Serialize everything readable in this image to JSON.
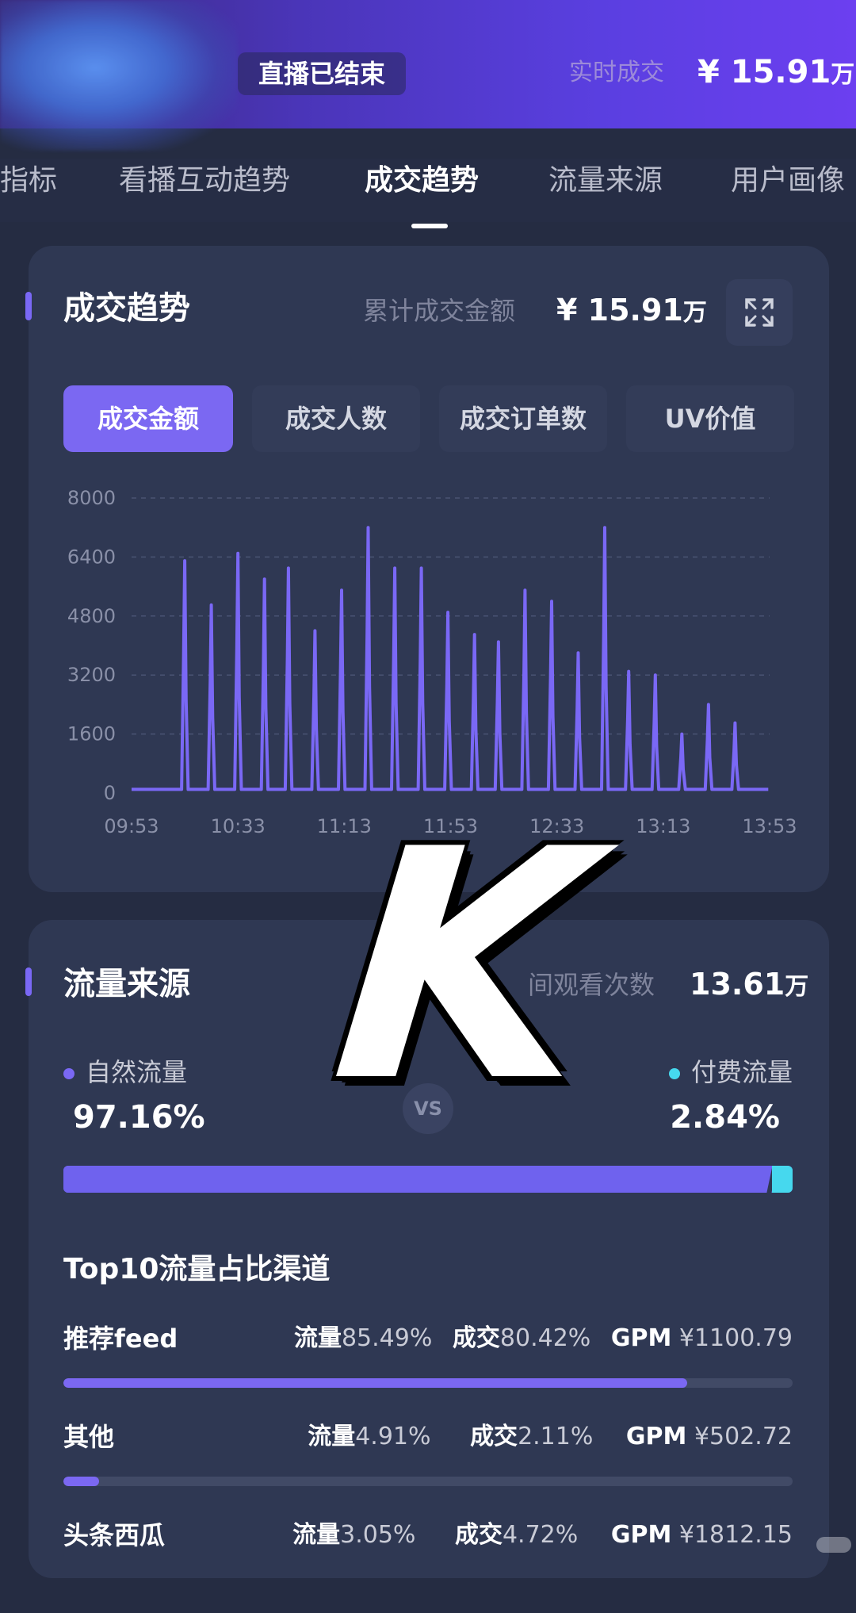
{
  "header": {
    "live_status": "直播已结束",
    "realtime_label": "实时成交",
    "realtime_value": "¥ 15.91",
    "realtime_unit": "万"
  },
  "tabs": [
    {
      "label": "指标"
    },
    {
      "label": "看播互动趋势"
    },
    {
      "label": "成交趋势",
      "active": true
    },
    {
      "label": "流量来源"
    },
    {
      "label": "用户画像"
    }
  ],
  "trade": {
    "title": "成交趋势",
    "summary_label": "累计成交金额",
    "summary_value": "¥ 15.91",
    "summary_unit": "万",
    "metric_buttons": [
      {
        "label": "成交金额",
        "active": true
      },
      {
        "label": "成交人数"
      },
      {
        "label": "成交订单数"
      },
      {
        "label": "UV价值"
      }
    ]
  },
  "chart_data": {
    "type": "line",
    "ylim": [
      0,
      8000
    ],
    "yticks": [
      "8000",
      "6400",
      "4800",
      "3200",
      "1600",
      "0"
    ],
    "xticks": [
      "09:53",
      "10:33",
      "11:13",
      "11:53",
      "12:33",
      "13:13",
      "13:53"
    ],
    "xlim_minutes_label": [
      "09:53",
      "13:53"
    ],
    "series": [
      {
        "color": "#7a68f5",
        "peaks": [
          {
            "time": "10:13",
            "value": 6300
          },
          {
            "time": "10:23",
            "value": 5100
          },
          {
            "time": "10:33",
            "value": 6500
          },
          {
            "time": "10:43",
            "value": 5800
          },
          {
            "time": "10:52",
            "value": 6100
          },
          {
            "time": "11:02",
            "value": 4400
          },
          {
            "time": "11:12",
            "value": 5500
          },
          {
            "time": "11:22",
            "value": 7200
          },
          {
            "time": "11:32",
            "value": 6100
          },
          {
            "time": "11:42",
            "value": 6100
          },
          {
            "time": "11:52",
            "value": 4900
          },
          {
            "time": "12:02",
            "value": 4300
          },
          {
            "time": "12:11",
            "value": 4100
          },
          {
            "time": "12:21",
            "value": 5500
          },
          {
            "time": "12:31",
            "value": 5200
          },
          {
            "time": "12:41",
            "value": 3800
          },
          {
            "time": "12:51",
            "value": 7200
          },
          {
            "time": "13:00",
            "value": 3300
          },
          {
            "time": "13:10",
            "value": 3200
          },
          {
            "time": "13:20",
            "value": 1600
          },
          {
            "time": "13:30",
            "value": 2400
          },
          {
            "time": "13:40",
            "value": 1900
          }
        ],
        "baseline": 100
      }
    ]
  },
  "traffic": {
    "title": "流量来源",
    "summary_label": "间观看次数",
    "summary_value": "13.61",
    "summary_unit": "万",
    "natural_label": "自然流量",
    "natural_pct": "97.16%",
    "natural_fraction": 0.9716,
    "paid_label": "付费流量",
    "paid_pct": "2.84%",
    "vs": "VS",
    "natural_color": "#6f62ee",
    "paid_color": "#46d8ee",
    "top10_title": "Top10流量占比渠道",
    "rows": [
      {
        "name": "推荐feed",
        "flow_label": "流量",
        "flow": "85.49%",
        "deal_label": "成交",
        "deal": "80.42%",
        "gpm_label": "GPM",
        "gpm": "¥1100.79",
        "fraction": 0.8549
      },
      {
        "name": "其他",
        "flow_label": "流量",
        "flow": "4.91%",
        "deal_label": "成交",
        "deal": "2.11%",
        "gpm_label": "GPM",
        "gpm": "¥502.72",
        "fraction": 0.0491
      },
      {
        "name": "头条西瓜",
        "flow_label": "流量",
        "flow": "3.05%",
        "deal_label": "成交",
        "deal": "4.72%",
        "gpm_label": "GPM",
        "gpm": "¥1812.15",
        "fraction": 0.0305
      }
    ]
  },
  "overlay": {
    "sticker_text": "K"
  }
}
